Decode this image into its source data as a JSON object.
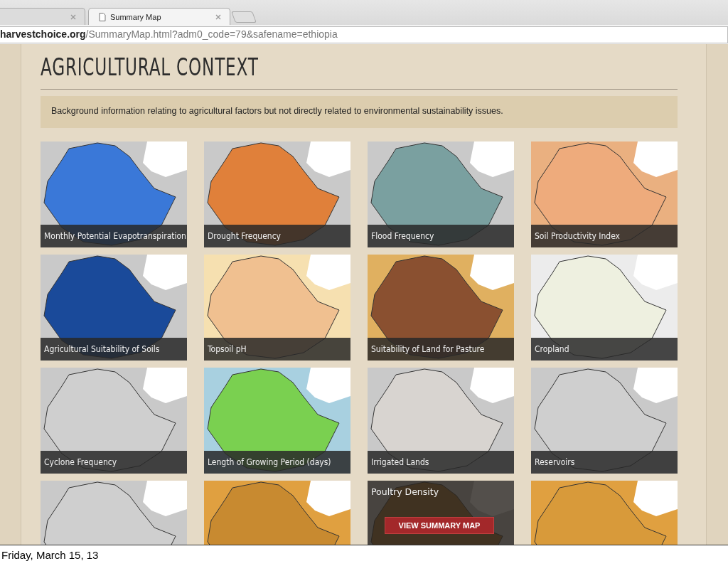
{
  "browser": {
    "tabs": [
      {
        "selected": false
      },
      {
        "title": "Summary Map",
        "selected": true
      }
    ],
    "address": "**harvestchoice.org**/SummaryMap.html?adm0_code=79&safename=ethiopia"
  },
  "section": {
    "heading": "AGRICULTURAL CONTEXT",
    "description": "Background information relating to agricultural factors but not directly related to environmental sustainability issues."
  },
  "tiles": [
    {
      "title": "Monthly Potential Evapotranspiration",
      "hovered": false
    },
    {
      "title": "Drought Frequency",
      "hovered": false
    },
    {
      "title": "Flood Frequency",
      "hovered": false
    },
    {
      "title": "Soil Productivity Index",
      "hovered": false
    },
    {
      "title": "Agricultural Suitability of Soils",
      "hovered": false
    },
    {
      "title": "Topsoil pH",
      "hovered": false
    },
    {
      "title": "Suitability of Land for Pasture",
      "hovered": false
    },
    {
      "title": "Cropland",
      "hovered": false
    },
    {
      "title": "Cyclone Frequency",
      "hovered": false
    },
    {
      "title": "Length of Growing Period (days)",
      "hovered": false
    },
    {
      "title": "Irrigated Lands",
      "hovered": false
    },
    {
      "title": "Reservoirs",
      "hovered": false
    },
    {
      "hovered": false
    },
    {
      "hovered": false
    },
    {
      "title": "Poultry Density",
      "hovered": true,
      "button": "VIEW SUMMARY MAP"
    },
    {
      "hovered": false
    }
  ],
  "caption": "Friday, March 15, 13"
}
